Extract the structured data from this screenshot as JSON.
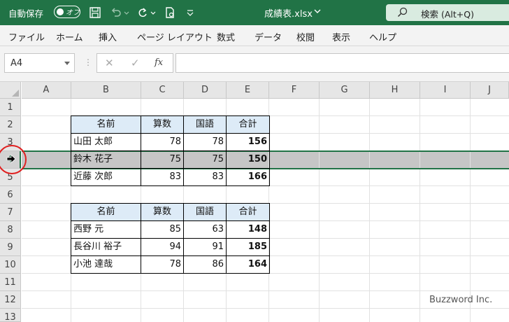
{
  "titlebar": {
    "autosave_label": "自動保存",
    "autosave_toggle": "オフ",
    "filename": "成績表.xlsx",
    "search_placeholder": "検索 (Alt+Q)"
  },
  "menu": [
    "ファイル",
    "ホーム",
    "挿入",
    "ページ レイアウト",
    "数式",
    "データ",
    "校閲",
    "表示",
    "ヘルプ"
  ],
  "formula_bar": {
    "name_box": "A4",
    "cancel_icon": "✕",
    "enter_icon": "✓",
    "fx_label": "fx",
    "formula": ""
  },
  "columns": [
    "A",
    "B",
    "C",
    "D",
    "E",
    "F",
    "G",
    "H",
    "I",
    "J"
  ],
  "rows": [
    "1",
    "2",
    "3",
    "4",
    "5",
    "6",
    "7",
    "8",
    "9",
    "10",
    "11",
    "12",
    "13"
  ],
  "selected_row": "4",
  "table1": {
    "headers": [
      "名前",
      "算数",
      "国語",
      "合計"
    ],
    "rows": [
      [
        "山田 太郎",
        "78",
        "78",
        "156"
      ],
      [
        "鈴木 花子",
        "75",
        "75",
        "150"
      ],
      [
        "近藤 次郎",
        "83",
        "83",
        "166"
      ]
    ]
  },
  "table2": {
    "headers": [
      "名前",
      "算数",
      "国語",
      "合計"
    ],
    "rows": [
      [
        "西野 元",
        "85",
        "63",
        "148"
      ],
      [
        "長谷川 裕子",
        "94",
        "91",
        "185"
      ],
      [
        "小池 達哉",
        "78",
        "86",
        "164"
      ]
    ]
  },
  "watermark": "Buzzword Inc.",
  "colors": {
    "excel_green": "#217346",
    "header_fill": "#ddebf7",
    "highlight": "#e02020"
  }
}
